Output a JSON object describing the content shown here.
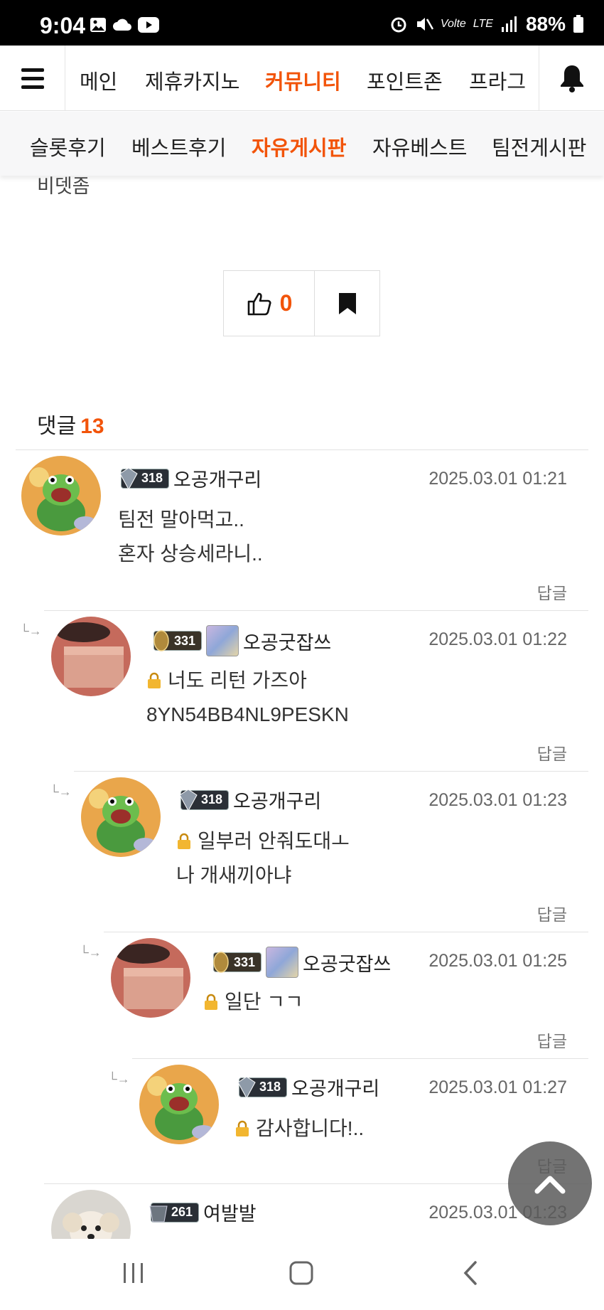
{
  "status_bar": {
    "time": "9:04",
    "volte": "Volte",
    "lte": "LTE",
    "battery": "88%"
  },
  "top_nav": {
    "items": [
      {
        "label": "메인",
        "active": false
      },
      {
        "label": "제휴카지노",
        "active": false
      },
      {
        "label": "커뮤니티",
        "active": true
      },
      {
        "label": "포인트존",
        "active": false
      },
      {
        "label": "프라그",
        "active": false
      }
    ]
  },
  "sub_nav": {
    "items": [
      {
        "label": "슬롯후기",
        "active": false
      },
      {
        "label": "베스트후기",
        "active": false
      },
      {
        "label": "자유게시판",
        "active": true
      },
      {
        "label": "자유베스트",
        "active": false
      },
      {
        "label": "팀전게시판",
        "active": false
      }
    ]
  },
  "post": {
    "tail_text": "비뎃좀",
    "like_count": "0"
  },
  "comments_header": {
    "label": "댓글",
    "count": "13"
  },
  "reply_label": "답글",
  "comments": [
    {
      "level": "318",
      "nickname": "오공개구리",
      "date": "2025.03.01 01:21",
      "lines": [
        "팀전 말아먹고..",
        "혼자 상승세라니.."
      ]
    },
    {
      "level": "331",
      "nickname": "오공굿잡쓰",
      "date": "2025.03.01 01:22",
      "lines": [
        "너도 리턴 가즈아",
        "8YN54BB4NL9PESKN"
      ]
    },
    {
      "level": "318",
      "nickname": "오공개구리",
      "date": "2025.03.01 01:23",
      "lines": [
        "일부러 안줘도대ㅗ",
        "나 개새끼아냐"
      ]
    },
    {
      "level": "331",
      "nickname": "오공굿잡쓰",
      "date": "2025.03.01 01:25",
      "lines": [
        "일단 ㄱㄱ"
      ]
    },
    {
      "level": "318",
      "nickname": "오공개구리",
      "date": "2025.03.01 01:27",
      "lines": [
        "감사합니다!.."
      ]
    },
    {
      "level": "261",
      "nickname": "여발발",
      "date": "2025.03.01 01:23",
      "lines": []
    }
  ],
  "colors": {
    "accent": "#f2540a",
    "status_bar": "#000000"
  }
}
